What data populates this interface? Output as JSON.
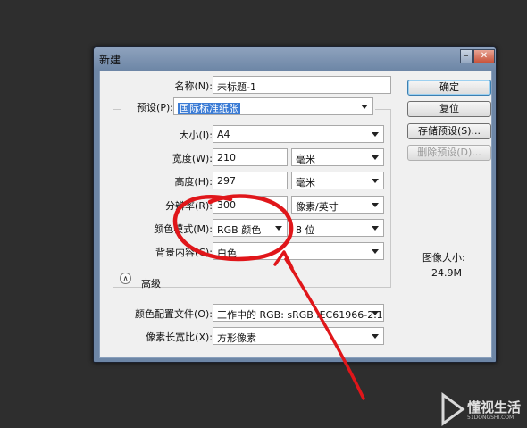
{
  "window": {
    "title": "新建",
    "close_glyph": "✕",
    "minimize_glyph": "–"
  },
  "form": {
    "name_label": "名称(N):",
    "name_value": "未标题-1",
    "preset_label": "预设(P):",
    "preset_value": "国际标准纸张",
    "size_label": "大小(I):",
    "size_value": "A4",
    "width_label": "宽度(W):",
    "width_value": "210",
    "width_unit": "毫米",
    "height_label": "高度(H):",
    "height_value": "297",
    "height_unit": "毫米",
    "resolution_label": "分辨率(R):",
    "resolution_value": "300",
    "resolution_unit": "像素/英寸",
    "color_mode_label": "颜色模式(M):",
    "color_mode_value": "RGB 颜色",
    "bit_depth": "8 位",
    "background_label": "背景内容(C):",
    "background_value": "白色",
    "advanced_label": "高级",
    "color_profile_label": "颜色配置文件(O):",
    "color_profile_value": "工作中的 RGB: sRGB IEC61966-2.1",
    "pixel_aspect_label": "像素长宽比(X):",
    "pixel_aspect_value": "方形像素"
  },
  "buttons": {
    "ok": "确定",
    "reset": "复位",
    "save_preset": "存储预设(S)...",
    "delete_preset": "删除预设(D)..."
  },
  "image_size": {
    "label": "图像大小:",
    "value": "24.9M"
  },
  "watermark": {
    "title": "懂视生活",
    "subtitle": "51DONGSHI.COM"
  },
  "colors": {
    "annotation": "#e0161a",
    "title_bar": "#6d86a6",
    "selection": "#3a7bd5"
  }
}
